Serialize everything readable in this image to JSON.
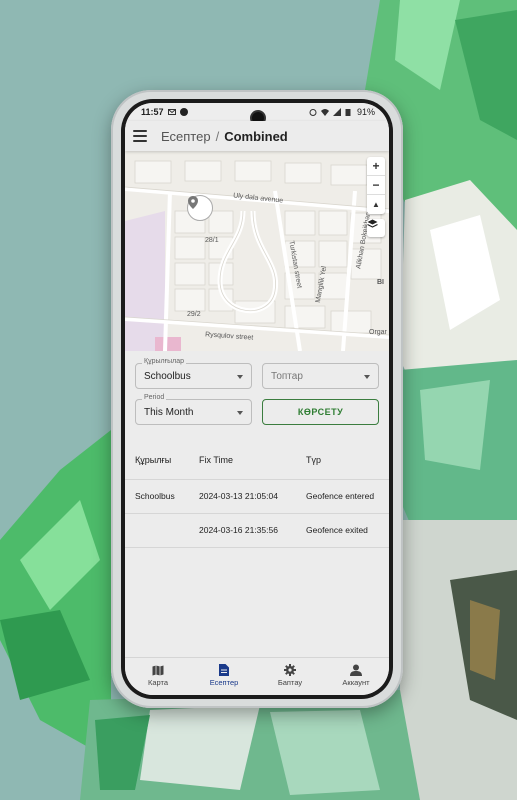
{
  "status_bar": {
    "time": "11:57",
    "battery": "91%"
  },
  "app_bar": {
    "parent": "Есептер",
    "separator": "/",
    "current": "Combined"
  },
  "map": {
    "labels": [
      "Uly dala avenue",
      "28/1",
      "Turkistan street",
      "Mangilik Yel",
      "Alikhan Bokeikhan",
      "29/2",
      "Rysqulov street",
      "BI",
      "Orgar"
    ],
    "zoom_in": "+",
    "zoom_out": "−",
    "compass": "▲"
  },
  "filters": {
    "device": {
      "label": "Құрылғылар",
      "value": "Schoolbus"
    },
    "groups": {
      "placeholder": "Топтар"
    },
    "period": {
      "label": "Period",
      "value": "This Month"
    },
    "show_button": "КӨРСЕТУ"
  },
  "table": {
    "headers": [
      "Құрылғы",
      "Fix Time",
      "Түр"
    ],
    "rows": [
      [
        "Schoolbus",
        "2024-03-13 21:05:04",
        "Geofence entered"
      ],
      [
        "",
        "2024-03-16 21:35:56",
        "Geofence exited"
      ]
    ]
  },
  "bottom_nav": [
    {
      "label": "Карта",
      "icon": "map-icon"
    },
    {
      "label": "Есептер",
      "icon": "report-icon"
    },
    {
      "label": "Баптау",
      "icon": "gear-icon"
    },
    {
      "label": "Аккаунт",
      "icon": "person-icon"
    }
  ],
  "colors": {
    "accent_green": "#2e7d32",
    "active_nav": "#1a3a8a",
    "background": "#8fb8b3"
  }
}
